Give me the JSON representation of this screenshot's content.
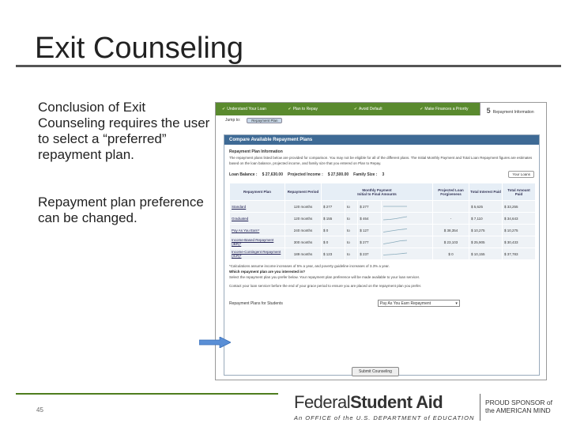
{
  "slide": {
    "title": "Exit Counseling",
    "bullets": [
      "Conclusion of Exit Counseling requires the user to select a “preferred” repayment plan.",
      "Repayment plan preference can be changed."
    ],
    "page_number": "45"
  },
  "branding": {
    "federal": "Federal",
    "student_aid": "Student Aid",
    "office_line": "An OFFICE of the U.S. DEPARTMENT of EDUCATION",
    "sponsor_line1": "PROUD SPONSOR of",
    "sponsor_line2": "the AMERICAN MIND",
    "accent_color": "#4e7d1e"
  },
  "screenshot": {
    "steps": [
      {
        "label": "Understand Your Loan",
        "done": true
      },
      {
        "label": "Plan to Repay",
        "done": true
      },
      {
        "label": "Avoid Default",
        "done": true
      },
      {
        "label": "Make Finances a Priority",
        "done": true
      },
      {
        "label": "Repayment Information",
        "number": "5",
        "active": true
      }
    ],
    "jump_to_label": "Jump to:",
    "jump_to_button": "Repayment Plan",
    "panel_title": "Compare Available Repayment Plans",
    "section_title": "Repayment Plan Information",
    "intro_text": "The repayment plans listed below are provided for comparison. You may not be eligible for all of the different plans. The Initial Monthly Payment and Total Loan Repayment figures are estimates based on the loan balance, projected income, and family size that you entered on Plan to Repay.",
    "loan_balance_label": "Loan Balance :",
    "loan_balance_value": "$ 27,630.00",
    "projected_income_label": "Projected Income :",
    "projected_income_value": "$ 27,500.00",
    "family_size_label": "Family Size :",
    "family_size_value": "3",
    "your_loans_button": "Your Loans",
    "columns": {
      "plan": "Repayment Plan",
      "period": "Repayment Period",
      "monthly": "Monthly Payment",
      "monthly_sub": "Initial to Final Amounts",
      "forgiveness": "Projected Loan Forgiveness",
      "interest": "Total Interest Paid",
      "total": "Total Amount Paid"
    },
    "rows": [
      {
        "plan": "Standard",
        "period": "120 months",
        "initial": "$ 277",
        "to": "to",
        "final": "$ 277",
        "forgiveness": "",
        "interest": "$ 5,625",
        "total": "$ 33,255"
      },
      {
        "plan": "Graduated",
        "period": "120 months",
        "initial": "$ 155",
        "to": "to",
        "final": "$ 464",
        "forgiveness": "-",
        "interest": "$ 7,110",
        "total": "$ 34,643"
      },
      {
        "plan": "Pay As You Earn*",
        "period": "240 months",
        "initial": "$ 0",
        "to": "to",
        "final": "$ 127",
        "forgiveness": "$ 38,354",
        "interest": "$ 10,275",
        "total": "$ 10,275"
      },
      {
        "plan": "Income-Based Repayment (IBR)*",
        "period": "300 months",
        "initial": "$ 0",
        "to": "to",
        "final": "$ 277",
        "forgiveness": "$ 23,103",
        "interest": "$ 25,905",
        "total": "$ 30,433"
      },
      {
        "plan": "Income-Contingent Repayment (ICR)*",
        "period": "189 months",
        "initial": "$ 123",
        "to": "to",
        "final": "$ 237",
        "forgiveness": "$ 0",
        "interest": "$ 10,155",
        "total": "$ 37,783"
      }
    ],
    "footnote": "*Calculations assume income increases of 5% a year, and poverty guideline increases of 3.3% a year.",
    "question": "Which repayment plan are you interested in?",
    "instruction": "Select the repayment plan you prefer below. Your repayment plan preference will be made available to your loan servicer.",
    "contact_note": "Contact your loan servicer before the end of your grace period to ensure you are placed on the repayment plan you prefer.",
    "preference_label": "Repayment Plans for Students",
    "preference_value": "Pay As You Earn Repayment",
    "submit_button": "Submit Counseling",
    "header_color": "#3e6a95",
    "steps_color": "#5a8a2e"
  }
}
